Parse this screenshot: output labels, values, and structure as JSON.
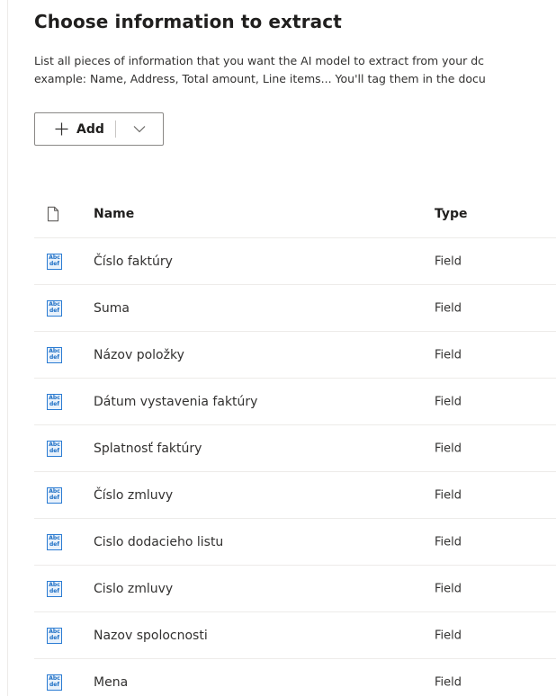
{
  "header": {
    "title": "Choose information to extract",
    "description_line1": "List all pieces of information that you want the AI model to extract from your dc",
    "description_line2": "example: Name, Address, Total amount, Line items... You'll tag them in the docu"
  },
  "toolbar": {
    "add_label": "Add",
    "add_icon": "plus-icon",
    "dropdown_icon": "chevron-down-icon"
  },
  "table": {
    "columns": {
      "icon": "document-icon",
      "name": "Name",
      "type": "Type"
    },
    "icon_glyph": {
      "top": "Abc",
      "bottom": "def"
    },
    "rows": [
      {
        "name": "Číslo faktúry",
        "type": "Field"
      },
      {
        "name": "Suma",
        "type": "Field"
      },
      {
        "name": "Názov položky",
        "type": "Field"
      },
      {
        "name": "Dátum vystavenia faktúry",
        "type": "Field"
      },
      {
        "name": "Splatnosť faktúry",
        "type": "Field"
      },
      {
        "name": "Číslo zmluvy",
        "type": "Field"
      },
      {
        "name": "Cislo dodacieho listu",
        "type": "Field"
      },
      {
        "name": "Cislo zmluvy",
        "type": "Field"
      },
      {
        "name": "Nazov spolocnosti",
        "type": "Field"
      },
      {
        "name": "Mena",
        "type": "Field"
      }
    ]
  },
  "colors": {
    "accent": "#2b7cd3",
    "border": "#8a8886",
    "divider": "#edebe9",
    "text": "#323130"
  }
}
